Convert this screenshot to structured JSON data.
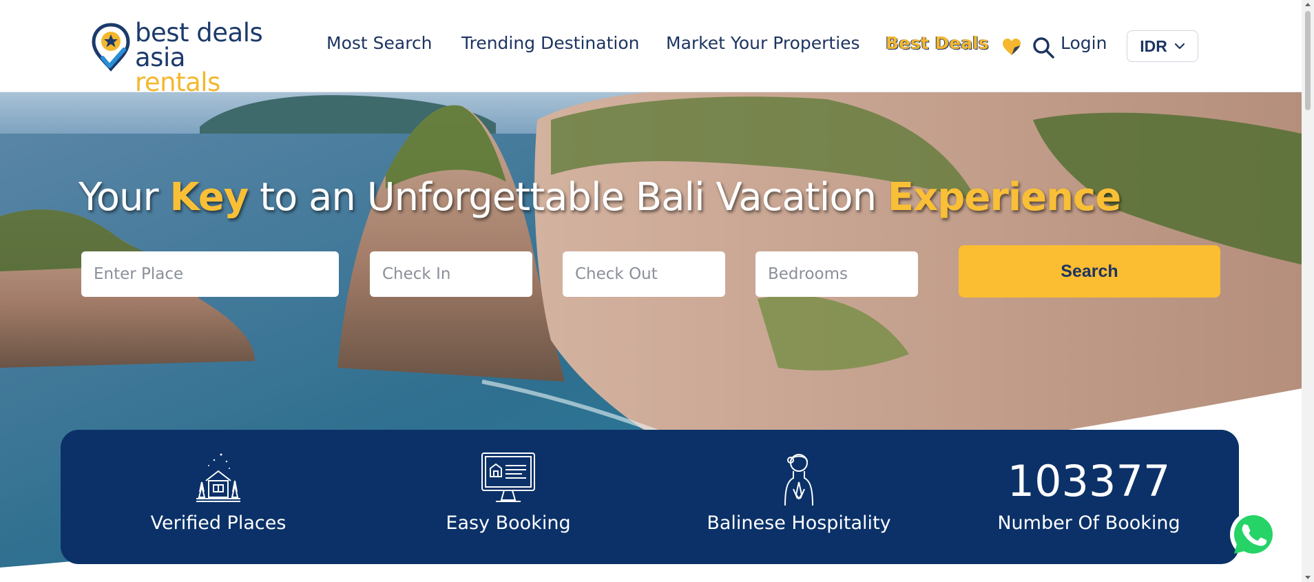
{
  "brand": {
    "line1": "best deals",
    "line2_part1": "asia",
    "line2_part2": "rentals",
    "colors": {
      "navy": "#1c3a6b",
      "yellow": "#f4b72e"
    }
  },
  "nav": {
    "items": [
      {
        "label": "Most Search"
      },
      {
        "label": "Trending Destination"
      },
      {
        "label": "Market Your Properties"
      },
      {
        "label": "Best Deals"
      }
    ],
    "login": "Login",
    "currency": "IDR",
    "icons": [
      "heart-icon",
      "search-icon",
      "chevron-down-icon"
    ]
  },
  "hero": {
    "title_parts": [
      "Your ",
      "Key",
      " to an Unforgettable Bali Vacation ",
      "Experience"
    ],
    "search": {
      "place_placeholder": "Enter Place",
      "checkin_placeholder": "Check In",
      "checkout_placeholder": "Check Out",
      "bedrooms_placeholder": "Bedrooms",
      "button_label": "Search"
    }
  },
  "stats": [
    {
      "label": "Verified Places",
      "icon": "house-trees-icon"
    },
    {
      "label": "Easy Booking",
      "icon": "computer-booking-icon"
    },
    {
      "label": "Balinese Hospitality",
      "icon": "balinese-greeting-icon"
    },
    {
      "label": "Number Of Booking",
      "value": "103377"
    }
  ],
  "floating": {
    "whatsapp_icon": "whatsapp-icon",
    "color": "#25d366"
  }
}
